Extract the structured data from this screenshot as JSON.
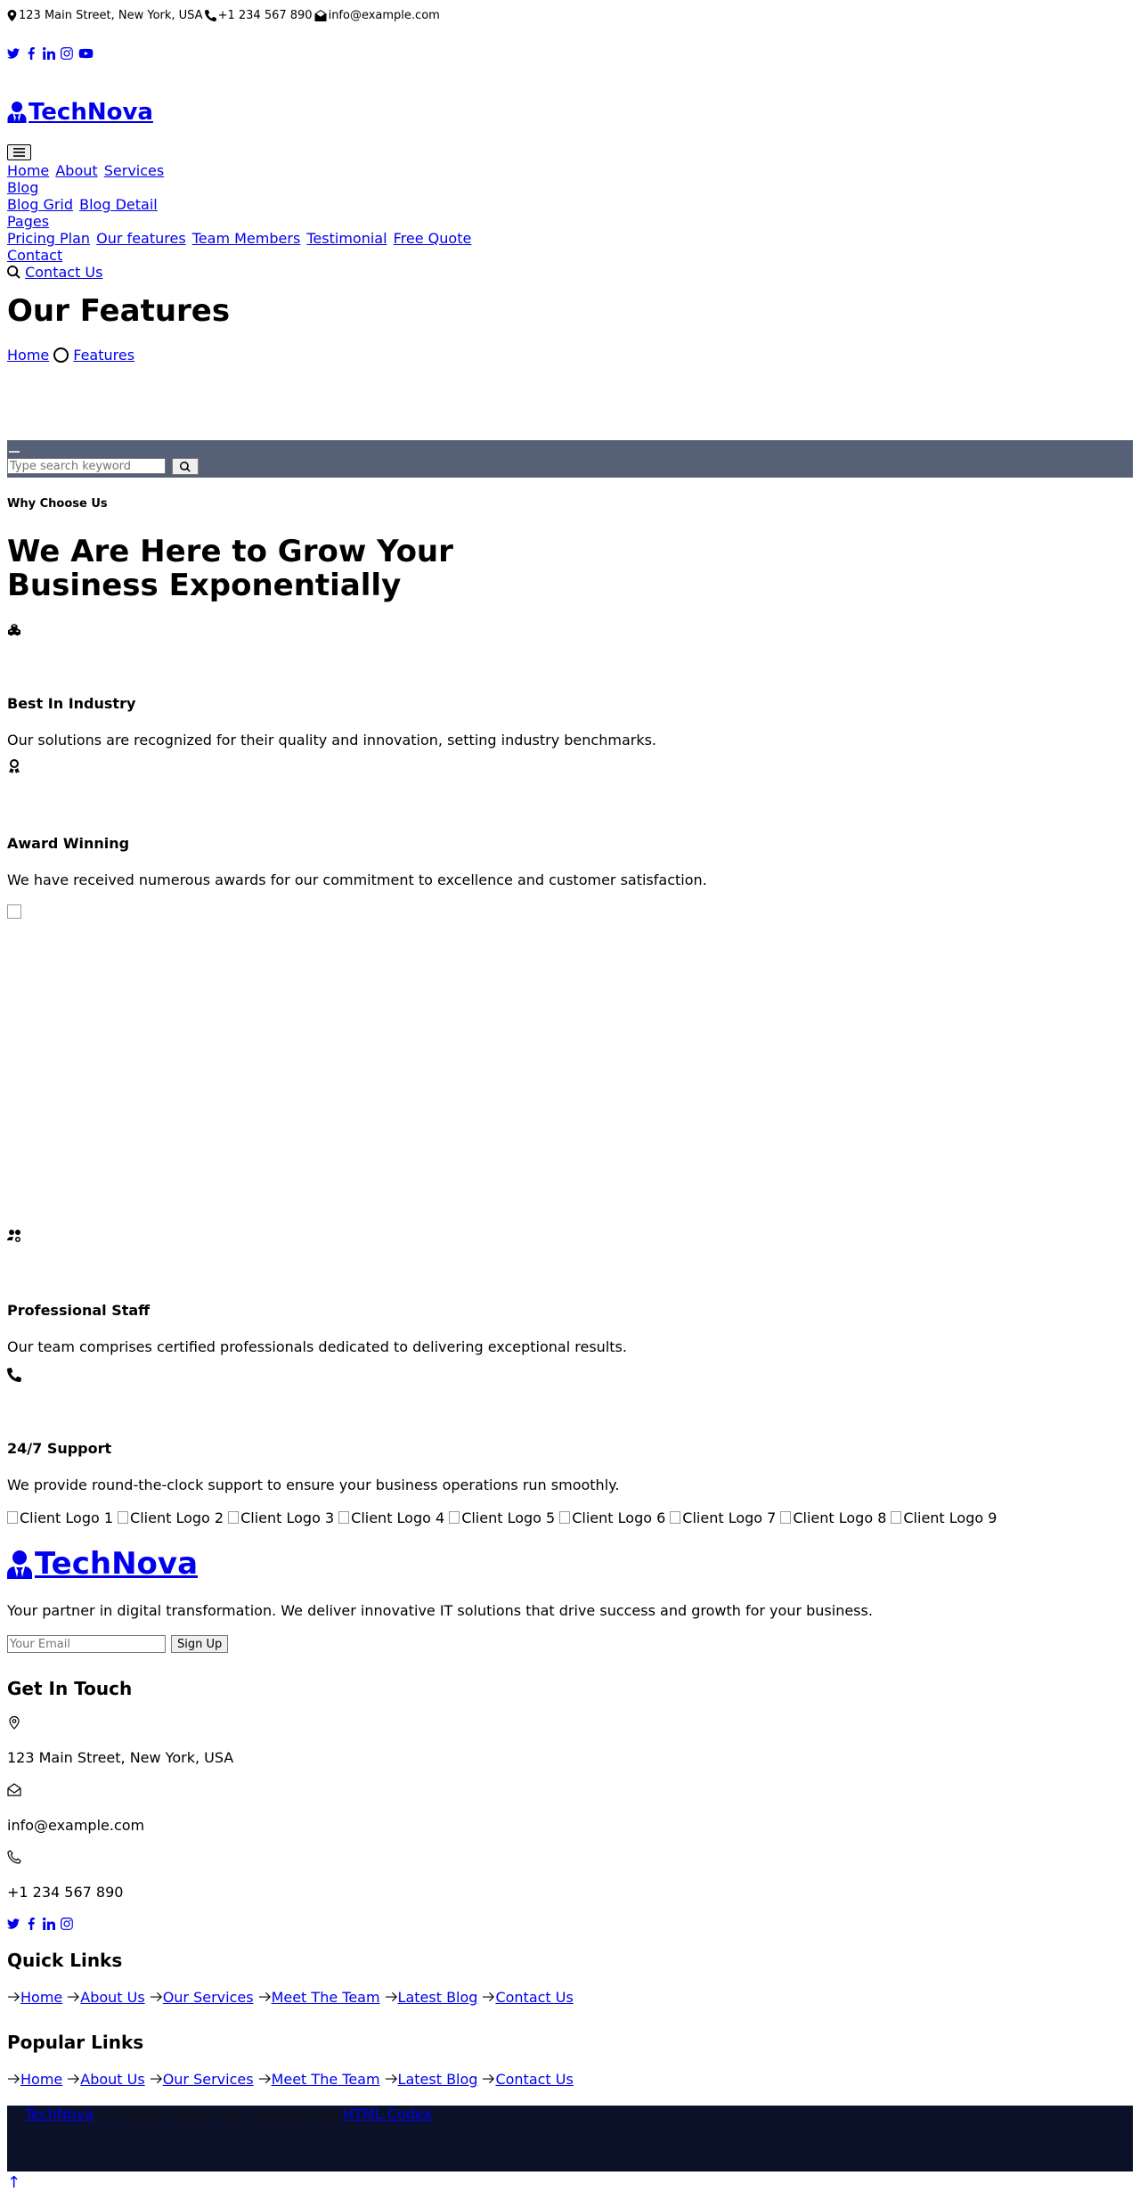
{
  "topbar": {
    "address": "123 Main Street, New York, USA",
    "phone": "+1 234 567 890",
    "email": "info@example.com"
  },
  "social_icons": [
    "twitter-icon",
    "facebook-icon",
    "linkedin-icon",
    "instagram-icon",
    "youtube-icon"
  ],
  "brand": {
    "name": "TechNova",
    "icon": "user-tie-icon"
  },
  "nav": {
    "toggler_icon": "hamburger-icon",
    "row1": [
      "Home",
      "About",
      "Services"
    ],
    "blog": "Blog",
    "blog_sub": [
      "Blog Grid",
      "Blog Detail"
    ],
    "pages": "Pages",
    "pages_sub": [
      "Pricing Plan",
      "Our features",
      "Team Members",
      "Testimonial",
      "Free Quote"
    ],
    "contact": "Contact",
    "contact_us": "Contact Us"
  },
  "page_header": {
    "title": "Our Features",
    "breadcrumb_home": "Home",
    "breadcrumb_current": "Features"
  },
  "search": {
    "placeholder": "Type search keyword"
  },
  "features": {
    "eyebrow": "Why Choose Us",
    "headline_line1": "We Are Here to Grow Your",
    "headline_line2": "Business Exponentially",
    "items": [
      {
        "icon": "cubes-icon",
        "title": "Best In Industry",
        "text": "Our solutions are recognized for their quality and innovation, setting industry benchmarks."
      },
      {
        "icon": "award-icon",
        "title": "Award Winning",
        "text": "We have received numerous awards for our commitment to excellence and customer satisfaction."
      },
      {
        "icon": "users-cog-icon",
        "title": "Professional Staff",
        "text": "Our team comprises certified professionals dedicated to delivering exceptional results."
      },
      {
        "icon": "phone-icon",
        "title": "24/7 Support",
        "text": "We provide round-the-clock support to ensure your business operations run smoothly."
      }
    ]
  },
  "clients": [
    "Client Logo 1",
    "Client Logo 2",
    "Client Logo 3",
    "Client Logo 4",
    "Client Logo 5",
    "Client Logo 6",
    "Client Logo 7",
    "Client Logo 8",
    "Client Logo 9"
  ],
  "footer": {
    "brand": "TechNova",
    "description": "Your partner in digital transformation. We deliver innovative IT solutions that drive success and growth for your business.",
    "email_placeholder": "Your Email",
    "signup": "Sign Up",
    "get_in_touch": "Get In Touch",
    "address": "123 Main Street, New York, USA",
    "email": "info@example.com",
    "phone": "+1 234 567 890",
    "quick_links_title": "Quick Links",
    "popular_links_title": "Popular Links",
    "links": [
      "Home",
      "About Us",
      "Our Services",
      "Meet The Team",
      "Latest Blog",
      "Contact Us"
    ],
    "copyright_brand": "TechNova",
    "copyright_text": ". All Rights Reserved. Designed by",
    "designer": "HTML Codex",
    "back_to_top": "↑"
  }
}
